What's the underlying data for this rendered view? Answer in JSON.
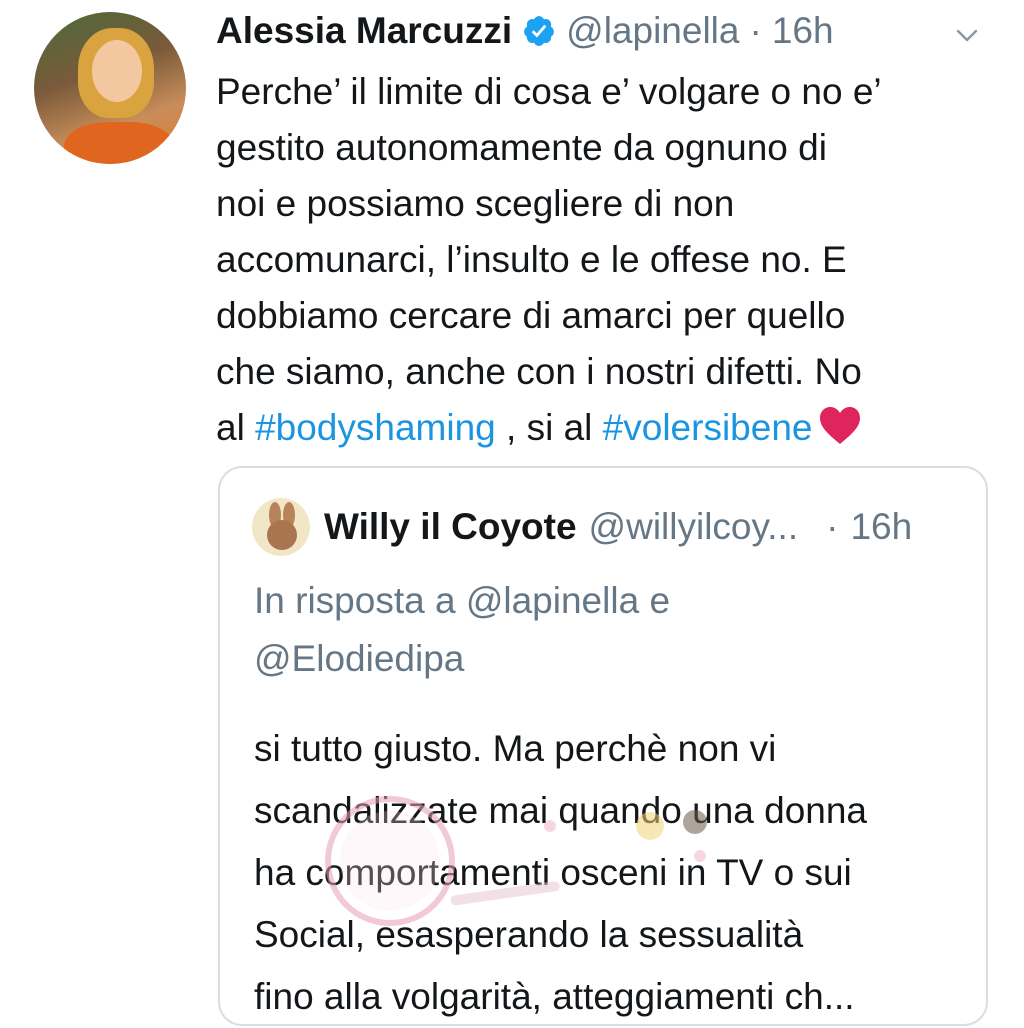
{
  "tweet": {
    "author_name": "Alessia Marcuzzi",
    "handle": "@lapinella",
    "separator": "·",
    "time": "16h",
    "text_lines": [
      "Perche’ il limite di cosa e’ volgare o no e’",
      "gestito autonomamente da ognuno di",
      "noi e possiamo scegliere di non",
      "accomunarci, l’insulto e le offese no. E",
      "dobbiamo cercare di amarci per quello",
      "che siamo, anche con i nostri difetti. No"
    ],
    "last_line": {
      "prefix": "al ",
      "hashtag1": "#bodyshaming",
      "middle": " , si al ",
      "hashtag2": "#volersibene"
    },
    "hashtag_color": "#1b95e0",
    "verified_color": "#1da1f2",
    "heart_color": "#e0245e"
  },
  "quoted_tweet": {
    "author_name": "Willy il Coyote",
    "handle": "@willyilcoy...",
    "separator": "·",
    "time": "16h",
    "reply_lines": [
      "In risposta a @lapinella e",
      "@Elodiedipa"
    ],
    "text_lines": [
      "si tutto giusto. Ma perchè non vi",
      "scandalizzate mai quando una donna",
      "ha comportamenti osceni in TV o sui",
      "Social, esasperando la sessualità",
      "fino alla volgarità, atteggiamenti ch..."
    ]
  },
  "icons": {
    "verified": "verified-badge-icon",
    "chevron": "chevron-down-icon",
    "heart": "red-heart-emoji"
  }
}
